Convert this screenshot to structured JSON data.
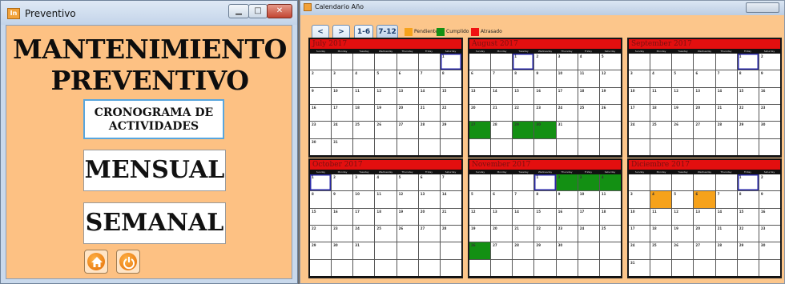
{
  "left_window": {
    "title": "Preventivo",
    "icon_text": "In",
    "controls": {
      "minimize": "▁",
      "maximize": "□",
      "close": "✕"
    },
    "heading_line1": "MANTENIMIENTO",
    "heading_line2": "PREVENTIVO",
    "cronograma_label": "CRONOGRAMA DE ACTIVIDADES",
    "mensual_label": "MENSUAL",
    "semanal_label": "SEMANAL",
    "home_icon": "home-icon",
    "power_icon": "power-icon"
  },
  "right_window": {
    "title": "Calendario Año",
    "nav": {
      "prev": "<",
      "next": ">",
      "range1": "1-6",
      "range2": "7-12"
    },
    "legend": [
      {
        "label": "Pendiente",
        "color": "#f6a21b"
      },
      {
        "label": "Cumplido",
        "color": "#139013"
      },
      {
        "label": "Atrasado",
        "color": "#f01212"
      }
    ],
    "weekdays": [
      "Sunday",
      "Monday",
      "Tuesday",
      "Wednesday",
      "Thursday",
      "Friday",
      "Saturday"
    ],
    "months": [
      {
        "name": "July 2017",
        "first": 6,
        "days": 31,
        "today": 1,
        "cumplido": [],
        "pendiente": []
      },
      {
        "name": "August 2017",
        "first": 2,
        "days": 31,
        "today": 1,
        "cumplido": [
          27,
          29,
          30
        ],
        "pendiente": []
      },
      {
        "name": "September 2017",
        "first": 5,
        "days": 30,
        "today": 1,
        "cumplido": [],
        "pendiente": []
      },
      {
        "name": "October 2017",
        "first": 0,
        "days": 31,
        "today": 1,
        "cumplido": [],
        "pendiente": []
      },
      {
        "name": "November 2017",
        "first": 3,
        "days": 30,
        "today": 1,
        "cumplido": [
          2,
          3,
          4,
          26
        ],
        "pendiente": []
      },
      {
        "name": "Diciembre 2017",
        "first": 5,
        "days": 31,
        "today": 1,
        "cumplido": [],
        "pendiente": [
          4,
          6
        ]
      }
    ]
  }
}
